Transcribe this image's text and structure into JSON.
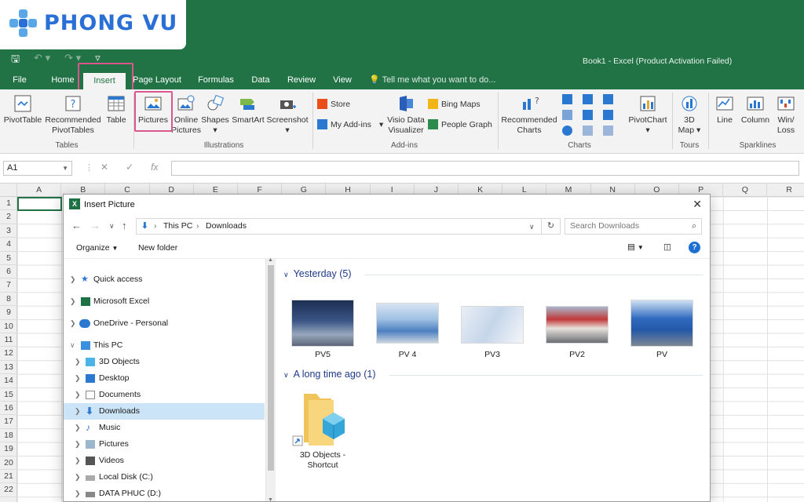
{
  "brand": {
    "logo_text": "PHONG VU"
  },
  "app": {
    "title": "Book1 - Excel (Product Activation Failed)"
  },
  "tabs": [
    {
      "label": "File"
    },
    {
      "label": "Home"
    },
    {
      "label": "Insert"
    },
    {
      "label": "Page Layout"
    },
    {
      "label": "Formulas"
    },
    {
      "label": "Data"
    },
    {
      "label": "Review"
    },
    {
      "label": "View"
    }
  ],
  "tell_me": "Tell me what you want to do...",
  "ribbon": {
    "tables": {
      "pivottable": "PivotTable",
      "recommended_pivot": [
        "Recommended",
        "PivotTables"
      ],
      "table": "Table",
      "group": "Tables"
    },
    "illustrations": {
      "pictures": "Pictures",
      "online_pictures": [
        "Online",
        "Pictures"
      ],
      "shapes": "Shapes",
      "smartart": "SmartArt",
      "screenshot": "Screenshot",
      "group": "Illustrations"
    },
    "addins": {
      "store": "Store",
      "my_addins": "My Add-ins",
      "visio": [
        "Visio Data",
        "Visualizer"
      ],
      "bing_maps": "Bing Maps",
      "people_graph": "People Graph",
      "group": "Add-ins"
    },
    "charts": {
      "recommended": [
        "Recommended",
        "Charts"
      ],
      "pivotchart": "PivotChart",
      "group": "Charts"
    },
    "tours": {
      "map3d": [
        "3D",
        "Map"
      ],
      "group": "Tours"
    },
    "sparklines": {
      "line": "Line",
      "column": "Column",
      "winloss": [
        "Win/",
        "Loss"
      ],
      "group": "Sparklines"
    }
  },
  "formula_bar": {
    "name_box": "A1"
  },
  "columns": [
    "A",
    "B",
    "C",
    "D",
    "E",
    "F",
    "G",
    "H",
    "I",
    "J",
    "K",
    "L",
    "M",
    "N",
    "O",
    "P",
    "Q",
    "R"
  ],
  "rows": [
    "1",
    "2",
    "3",
    "4",
    "5",
    "6",
    "7",
    "8",
    "9",
    "10",
    "11",
    "12",
    "13",
    "14",
    "15",
    "16",
    "17",
    "18",
    "19",
    "20",
    "21",
    "22"
  ],
  "dialog": {
    "title": "Insert Picture",
    "breadcrumbs": [
      "This PC",
      "Downloads"
    ],
    "search_placeholder": "Search Downloads",
    "toolbar": {
      "organize": "Organize",
      "new_folder": "New folder"
    },
    "nav": [
      {
        "label": "Quick access"
      },
      {
        "label": "Microsoft Excel"
      },
      {
        "label": "OneDrive - Personal"
      },
      {
        "label": "This PC"
      },
      {
        "label": "3D Objects"
      },
      {
        "label": "Desktop"
      },
      {
        "label": "Documents"
      },
      {
        "label": "Downloads"
      },
      {
        "label": "Music"
      },
      {
        "label": "Pictures"
      },
      {
        "label": "Videos"
      },
      {
        "label": "Local Disk (C:)"
      },
      {
        "label": "DATA PHUC (D:)"
      }
    ],
    "groups": [
      {
        "header": "Yesterday (5)"
      },
      {
        "header": "A long time ago (1)"
      }
    ],
    "files": [
      {
        "name": "PV5"
      },
      {
        "name": "PV 4"
      },
      {
        "name": "PV3"
      },
      {
        "name": "PV2"
      },
      {
        "name": "PV"
      }
    ],
    "shortcut": [
      "3D Objects -",
      "Shortcut"
    ]
  },
  "colors": {
    "excel_green": "#217346",
    "highlight": "#d9578c",
    "brand_blue": "#2a6fd6"
  }
}
